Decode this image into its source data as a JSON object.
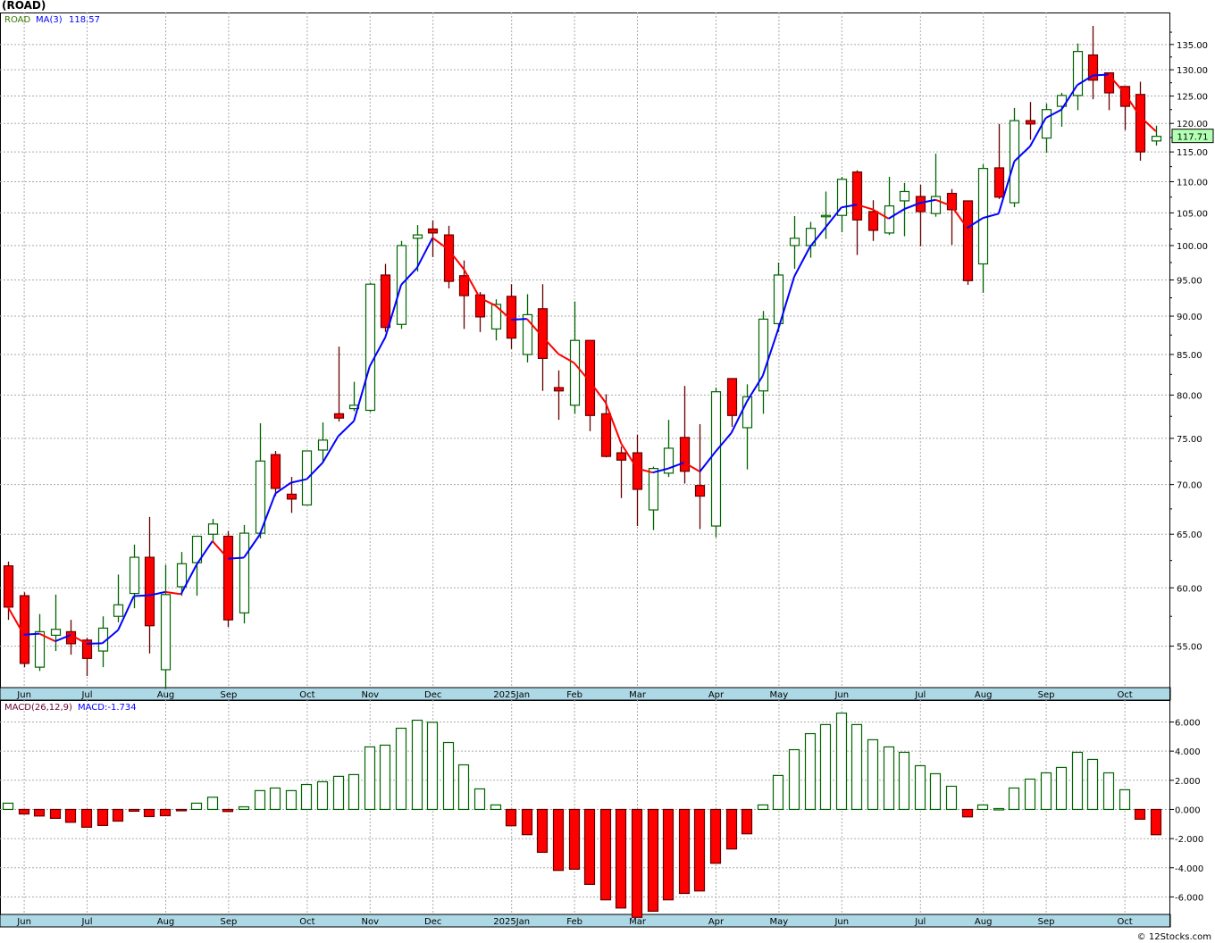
{
  "title": "(ROAD)",
  "footer": "© 12Stocks.com",
  "colors": {
    "up": "#006400",
    "down": "#ff0000",
    "down_outline": "#660000",
    "ma_up": "#0000ff",
    "ma_down": "#ff0000",
    "date_strip": "#add8e6",
    "last_price_bg": "#b3ffb3"
  },
  "chart_data": [
    {
      "type": "candlestick",
      "legend": {
        "symbol": "ROAD",
        "ma_label": "MA(3)",
        "ma_value": "118.57"
      },
      "last_price": "117.71",
      "y_scale": "log",
      "ylim": [
        51.7,
        141.6
      ],
      "y_ticks": [
        "55.00",
        "60.00",
        "65.00",
        "70.00",
        "75.00",
        "80.00",
        "85.00",
        "90.00",
        "95.00",
        "100.00",
        "105.00",
        "110.00",
        "115.00",
        "120.00",
        "125.00",
        "130.00",
        "135.00"
      ],
      "grid": true,
      "x_month_ticks": [
        {
          "label": "Jun",
          "week": 1
        },
        {
          "label": "Jul",
          "week": 5
        },
        {
          "label": "Aug",
          "week": 10
        },
        {
          "label": "Sep",
          "week": 14
        },
        {
          "label": "Oct",
          "week": 19
        },
        {
          "label": "Nov",
          "week": 23
        },
        {
          "label": "Dec",
          "week": 27
        },
        {
          "label": "2025Jan",
          "week": 32
        },
        {
          "label": "Feb",
          "week": 36
        },
        {
          "label": "Mar",
          "week": 40
        },
        {
          "label": "Apr",
          "week": 45
        },
        {
          "label": "May",
          "week": 49
        },
        {
          "label": "Jun",
          "week": 53
        },
        {
          "label": "Jul",
          "week": 58
        },
        {
          "label": "Aug",
          "week": 62
        },
        {
          "label": "Sep",
          "week": 66
        },
        {
          "label": "Oct",
          "week": 71
        }
      ],
      "ohlc": [
        [
          62.0,
          62.4,
          57.2,
          58.3
        ],
        [
          59.3,
          59.6,
          53.3,
          53.6
        ],
        [
          53.3,
          57.7,
          53.0,
          56.2
        ],
        [
          55.9,
          59.4,
          54.6,
          56.4
        ],
        [
          56.2,
          57.2,
          54.3,
          55.2
        ],
        [
          55.5,
          55.7,
          52.6,
          54.0
        ],
        [
          54.6,
          57.5,
          53.3,
          56.5
        ],
        [
          57.5,
          61.2,
          57.0,
          58.5
        ],
        [
          59.5,
          64.0,
          58.2,
          62.8
        ],
        [
          62.8,
          66.7,
          54.4,
          56.7
        ],
        [
          53.1,
          62.1,
          51.6,
          59.4
        ],
        [
          60.1,
          63.3,
          59.3,
          62.2
        ],
        [
          62.3,
          64.8,
          59.3,
          64.8
        ],
        [
          65.0,
          66.5,
          64.2,
          66.0
        ],
        [
          64.8,
          65.3,
          56.6,
          57.2
        ],
        [
          57.8,
          65.9,
          56.9,
          65.1
        ],
        [
          65.1,
          76.7,
          64.6,
          72.5
        ],
        [
          73.2,
          73.6,
          68.8,
          69.6
        ],
        [
          69.0,
          70.8,
          67.1,
          68.5
        ],
        [
          67.9,
          73.6,
          67.9,
          73.6
        ],
        [
          73.7,
          76.8,
          72.3,
          74.8
        ],
        [
          77.8,
          86.0,
          76.9,
          77.3
        ],
        [
          78.4,
          81.6,
          78.1,
          78.8
        ],
        [
          78.2,
          94.6,
          78.0,
          94.4
        ],
        [
          95.7,
          97.3,
          87.9,
          88.5
        ],
        [
          88.9,
          100.7,
          88.3,
          100.0
        ],
        [
          101.1,
          103.1,
          96.2,
          101.6
        ],
        [
          102.5,
          103.8,
          98.3,
          101.9
        ],
        [
          101.6,
          103.0,
          93.8,
          94.8
        ],
        [
          95.6,
          97.8,
          88.3,
          92.8
        ],
        [
          92.9,
          93.3,
          87.9,
          89.9
        ],
        [
          88.3,
          92.3,
          86.8,
          91.6
        ],
        [
          92.7,
          94.4,
          85.7,
          87.1
        ],
        [
          85.0,
          93.0,
          84.0,
          90.2
        ],
        [
          91.0,
          94.4,
          80.5,
          84.5
        ],
        [
          80.9,
          83.0,
          77.1,
          80.5
        ],
        [
          78.8,
          92.0,
          77.8,
          86.8
        ],
        [
          86.8,
          86.8,
          75.8,
          77.6
        ],
        [
          77.8,
          80.1,
          72.9,
          73.0
        ],
        [
          73.4,
          74.1,
          68.6,
          72.6
        ],
        [
          73.4,
          75.4,
          65.8,
          69.5
        ],
        [
          67.4,
          71.9,
          65.4,
          71.7
        ],
        [
          71.2,
          77.1,
          70.8,
          73.9
        ],
        [
          75.1,
          81.1,
          70.1,
          71.4
        ],
        [
          69.9,
          76.6,
          65.5,
          68.8
        ],
        [
          65.8,
          80.9,
          64.7,
          80.4
        ],
        [
          82.0,
          82.0,
          76.3,
          77.6
        ],
        [
          76.2,
          81.3,
          71.6,
          79.8
        ],
        [
          80.5,
          90.7,
          77.8,
          89.6
        ],
        [
          89.0,
          97.5,
          87.9,
          95.7
        ],
        [
          100.0,
          104.5,
          96.6,
          101.1
        ],
        [
          100.0,
          103.6,
          98.2,
          102.6
        ],
        [
          104.4,
          108.4,
          101.0,
          104.6
        ],
        [
          104.6,
          110.8,
          102.0,
          110.4
        ],
        [
          111.6,
          111.9,
          98.6,
          103.9
        ],
        [
          105.2,
          107.0,
          100.7,
          102.3
        ],
        [
          101.9,
          110.8,
          101.6,
          106.1
        ],
        [
          106.9,
          109.8,
          101.4,
          108.4
        ],
        [
          107.6,
          109.5,
          99.9,
          105.2
        ],
        [
          104.9,
          114.7,
          104.4,
          107.6
        ],
        [
          108.1,
          108.8,
          100.1,
          105.5
        ],
        [
          106.9,
          106.9,
          94.3,
          94.9
        ],
        [
          97.3,
          112.9,
          93.2,
          112.2
        ],
        [
          112.3,
          119.9,
          107.2,
          107.5
        ],
        [
          106.6,
          122.8,
          105.9,
          120.5
        ],
        [
          120.5,
          123.9,
          117.1,
          119.9
        ],
        [
          117.4,
          123.6,
          114.9,
          122.5
        ],
        [
          123.1,
          125.6,
          119.4,
          125.1
        ],
        [
          125.1,
          135.2,
          122.4,
          133.6
        ],
        [
          132.9,
          138.8,
          124.4,
          128.0
        ],
        [
          129.4,
          129.4,
          122.4,
          125.6
        ],
        [
          126.8,
          126.8,
          118.8,
          123.1
        ],
        [
          125.3,
          127.7,
          113.5,
          115.0
        ],
        [
          116.9,
          119.6,
          116.1,
          117.71
        ]
      ]
    },
    {
      "type": "bar",
      "legend": {
        "label": "MACD(26,12,9)",
        "value_label": "MACD:-1.734"
      },
      "ylim": [
        -7.2,
        7.5
      ],
      "y_ticks": [
        "-6.000",
        "-4.000",
        "-2.000",
        "0.000",
        "2.000",
        "4.000",
        "6.000"
      ],
      "grid": true,
      "values": [
        0.43,
        -0.31,
        -0.45,
        -0.61,
        -0.88,
        -1.22,
        -1.1,
        -0.8,
        -0.12,
        -0.49,
        -0.43,
        -0.06,
        0.43,
        0.84,
        -0.14,
        0.18,
        1.29,
        1.47,
        1.29,
        1.71,
        1.9,
        2.27,
        2.39,
        4.29,
        4.41,
        5.57,
        6.12,
        5.98,
        4.59,
        3.06,
        1.41,
        0.31,
        -1.12,
        -1.73,
        -2.94,
        -4.18,
        -4.1,
        -5.14,
        -6.2,
        -6.76,
        -7.4,
        -6.98,
        -6.2,
        -5.76,
        -5.59,
        -3.69,
        -2.71,
        -1.67,
        0.31,
        2.33,
        4.1,
        5.2,
        5.82,
        6.61,
        5.82,
        4.78,
        4.29,
        3.92,
        3.0,
        2.45,
        1.59,
        -0.51,
        0.31,
        0.06,
        1.47,
        2.08,
        2.51,
        2.88,
        3.92,
        3.43,
        2.51,
        1.35,
        -0.67,
        -1.734
      ]
    }
  ]
}
